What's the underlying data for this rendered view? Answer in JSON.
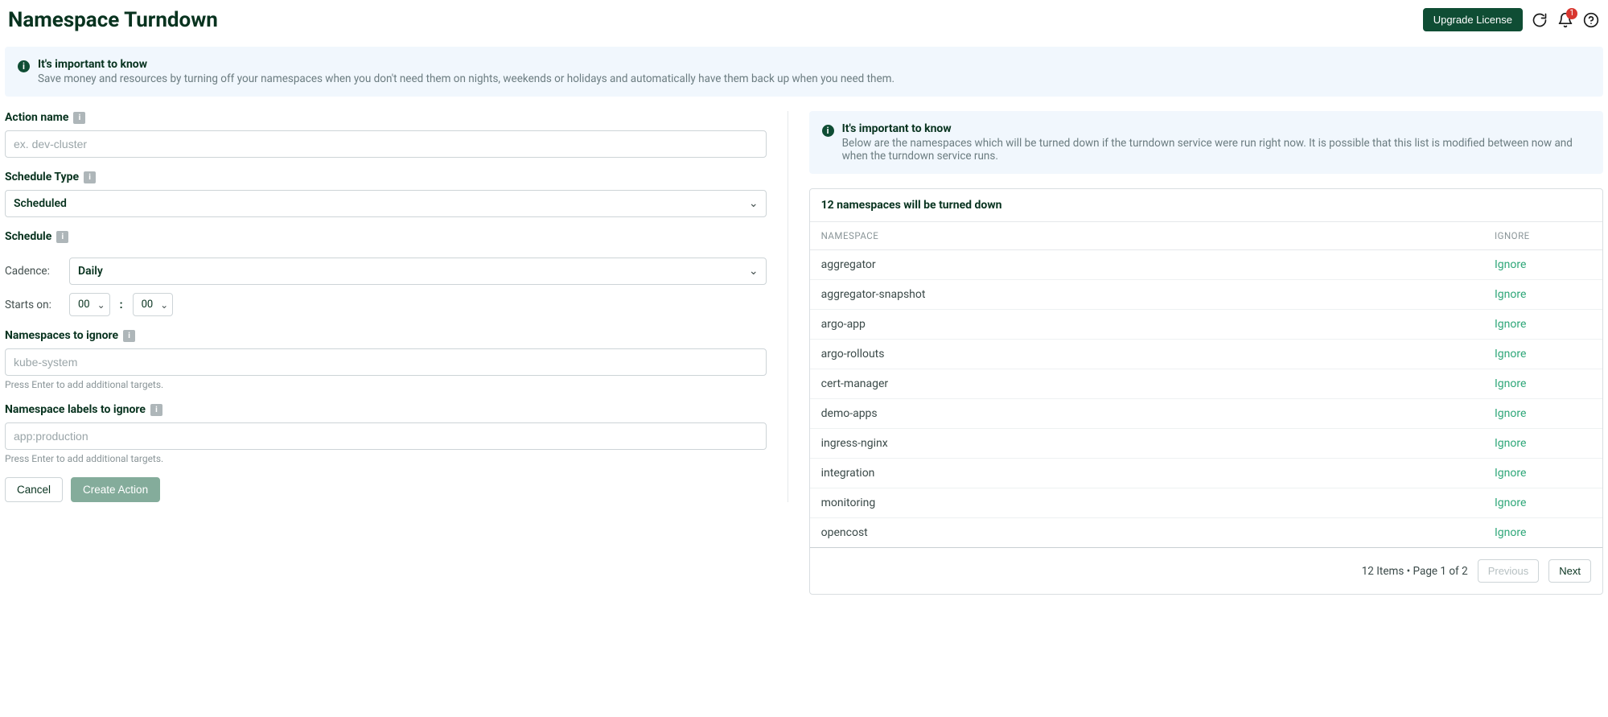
{
  "header": {
    "title": "Namespace Turndown",
    "upgrade_label": "Upgrade License",
    "notification_count": "1"
  },
  "top_banner": {
    "title": "It's important to know",
    "desc": "Save money and resources by turning off your namespaces when you don't need them on nights, weekends or holidays and automatically have them back up when you need them."
  },
  "form": {
    "action_name": {
      "label": "Action name",
      "placeholder": "ex. dev-cluster",
      "value": ""
    },
    "schedule_type": {
      "label": "Schedule Type",
      "value": "Scheduled"
    },
    "schedule": {
      "label": "Schedule",
      "cadence_label": "Cadence:",
      "cadence_value": "Daily",
      "starts_on_label": "Starts on:",
      "hour": "00",
      "minute": "00",
      "colon": ":"
    },
    "ns_ignore": {
      "label": "Namespaces to ignore",
      "placeholder": "kube-system",
      "hint": "Press Enter to add additional targets."
    },
    "labels_ignore": {
      "label": "Namespace labels to ignore",
      "placeholder": "app:production",
      "hint": "Press Enter to add additional targets."
    },
    "cancel_label": "Cancel",
    "create_label": "Create Action"
  },
  "right_banner": {
    "title": "It's important to know",
    "desc": "Below are the namespaces which will be turned down if the turndown service were run right now. It is possible that this list is modified between now and when the turndown service runs."
  },
  "table": {
    "header": "12 namespaces will be turned down",
    "col_namespace": "NAMESPACE",
    "col_ignore": "IGNORE",
    "ignore_label": "Ignore",
    "rows": [
      "aggregator",
      "aggregator-snapshot",
      "argo-app",
      "argo-rollouts",
      "cert-manager",
      "demo-apps",
      "ingress-nginx",
      "integration",
      "monitoring",
      "opencost"
    ],
    "pager": {
      "text": "12 Items • Page 1 of 2",
      "prev": "Previous",
      "next": "Next"
    }
  }
}
